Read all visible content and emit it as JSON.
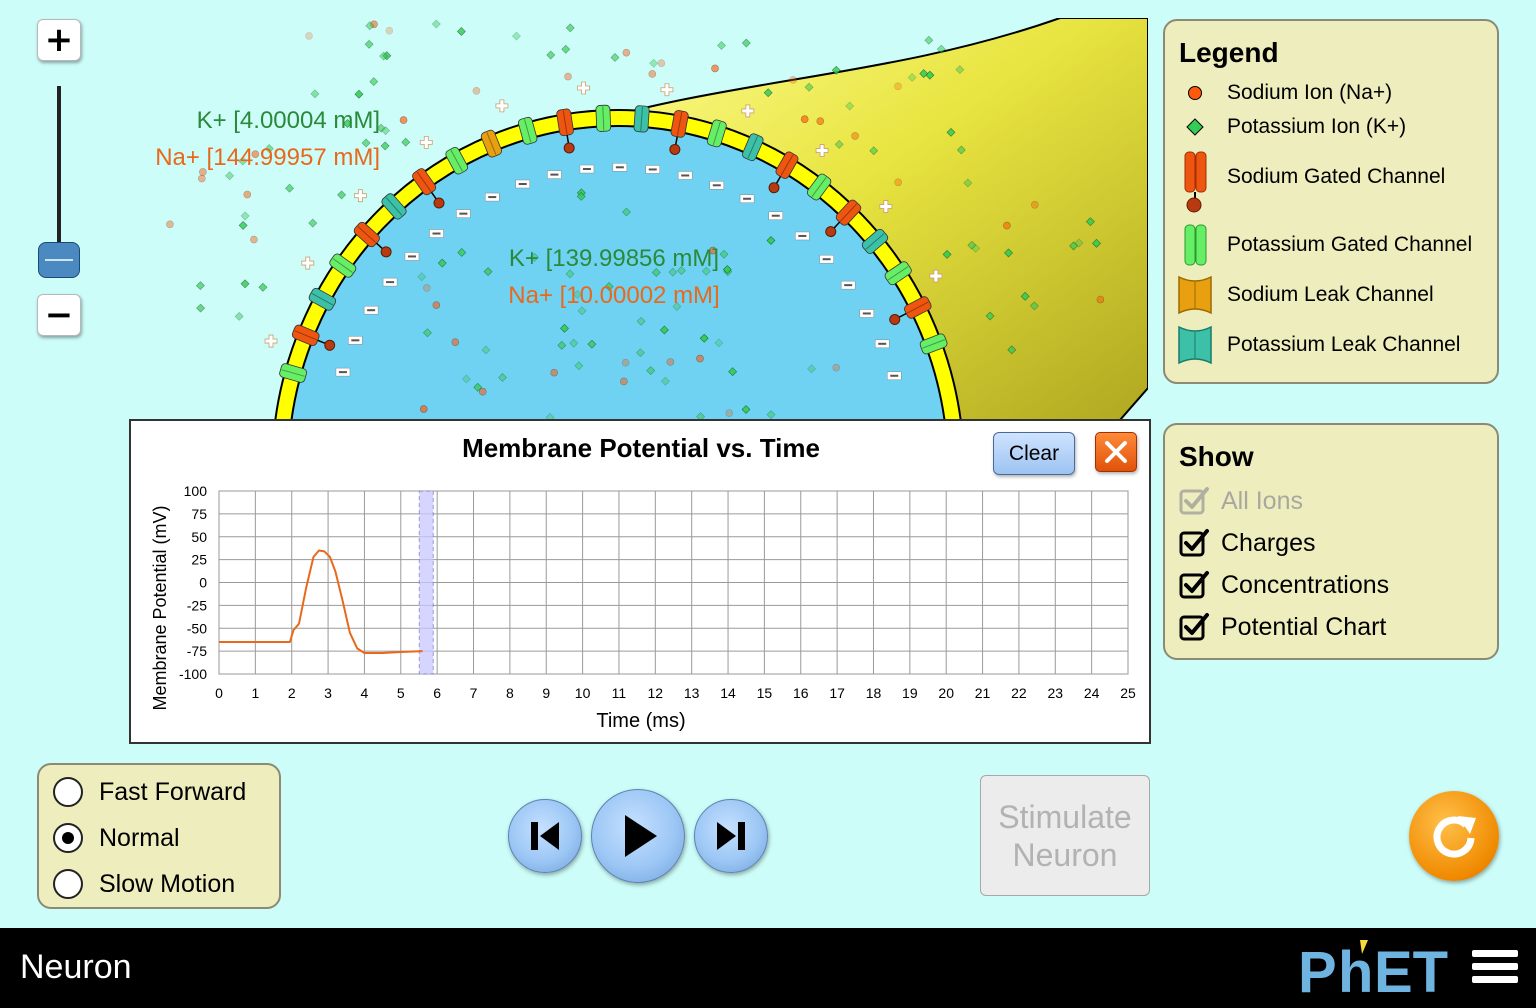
{
  "app": {
    "title": "Neuron"
  },
  "zoom": {
    "in_label": "+",
    "out_label": "−",
    "level": 0.2
  },
  "concentrations": {
    "outside": {
      "k": "K+ [4.00004 mM]",
      "na": "Na+ [144.99957 mM]"
    },
    "inside": {
      "k": "K+ [139.99856 mM]",
      "na": "Na+ [10.00002 mM]"
    }
  },
  "legend": {
    "title": "Legend",
    "items": [
      {
        "label": "Sodium Ion (Na+)",
        "icon": "sodium-ion-icon"
      },
      {
        "label": "Potassium Ion (K+)",
        "icon": "potassium-ion-icon"
      },
      {
        "label": "Sodium Gated Channel",
        "icon": "sodium-gated-channel-icon"
      },
      {
        "label": "Potassium Gated Channel",
        "icon": "potassium-gated-channel-icon"
      },
      {
        "label": "Sodium Leak Channel",
        "icon": "sodium-leak-channel-icon"
      },
      {
        "label": "Potassium Leak Channel",
        "icon": "potassium-leak-channel-icon"
      }
    ]
  },
  "show": {
    "title": "Show",
    "items": [
      {
        "label": "All Ions",
        "checked": true,
        "disabled": true
      },
      {
        "label": "Charges",
        "checked": true,
        "disabled": false
      },
      {
        "label": "Concentrations",
        "checked": true,
        "disabled": false
      },
      {
        "label": "Potential Chart",
        "checked": true,
        "disabled": false
      }
    ]
  },
  "chart_panel": {
    "clear_label": "Clear",
    "close_icon": "close-icon"
  },
  "chart_data": {
    "type": "line",
    "title": "Membrane Potential vs. Time",
    "xlabel": "Time (ms)",
    "ylabel": "Membrane Potential (mV)",
    "xlim": [
      0,
      25
    ],
    "ylim": [
      -100,
      100
    ],
    "x_ticks": [
      "0",
      "1",
      "2",
      "3",
      "4",
      "5",
      "6",
      "7",
      "8",
      "9",
      "10",
      "11",
      "12",
      "13",
      "14",
      "15",
      "16",
      "17",
      "18",
      "19",
      "20",
      "21",
      "22",
      "23",
      "24",
      "25"
    ],
    "y_ticks": [
      "100",
      "75",
      "50",
      "25",
      "0",
      "-25",
      "-50",
      "-75",
      "-100"
    ],
    "grid": true,
    "cursor_time": 5.7,
    "series": [
      {
        "color": "#e8691c",
        "x": [
          0,
          1,
          1.95,
          2.05,
          2.2,
          2.4,
          2.6,
          2.75,
          2.9,
          3.05,
          3.2,
          3.4,
          3.6,
          3.8,
          4.0,
          4.5,
          5.0,
          5.6
        ],
        "y": [
          -65,
          -65,
          -65,
          -52,
          -45,
          -5,
          28,
          35,
          34,
          28,
          12,
          -20,
          -55,
          -72,
          -77,
          -77,
          -76,
          -75
        ]
      }
    ]
  },
  "speed": {
    "options": [
      "Fast Forward",
      "Normal",
      "Slow Motion"
    ],
    "selected": "Normal"
  },
  "playback": {
    "back_icon": "step-back-icon",
    "play_icon": "play-icon",
    "forward_icon": "step-forward-icon"
  },
  "stimulate": {
    "line1": "Stimulate",
    "line2": "Neuron"
  },
  "colors": {
    "background": "#cdfdf9",
    "cell_inside": "#6fd2f2",
    "membrane": "#ffff00",
    "outside_tissue": "#d4c83a",
    "sodium": "#ff5a0a",
    "potassium": "#33cc55"
  }
}
